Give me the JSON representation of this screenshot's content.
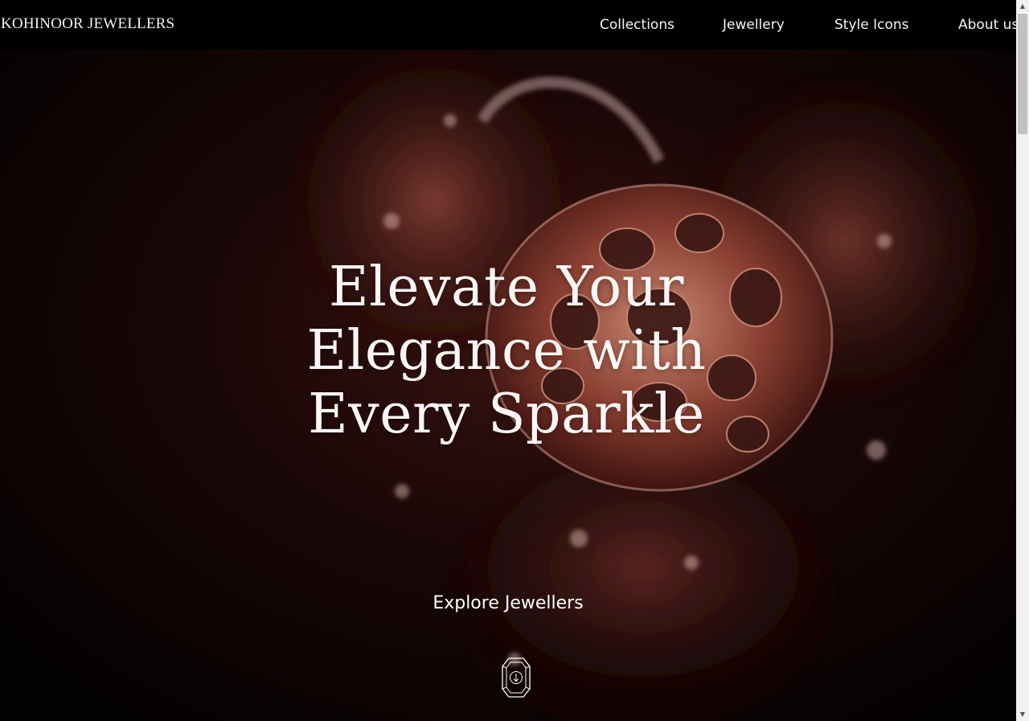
{
  "header": {
    "brand": "KOHINOOR JEWELLERS",
    "nav": [
      {
        "label": "Collections"
      },
      {
        "label": "Jewellery"
      },
      {
        "label": "Style Icons"
      },
      {
        "label": "About us"
      }
    ]
  },
  "hero": {
    "headline_lines": [
      "Elevate Your",
      "Elegance with",
      "Every Sparkle"
    ],
    "cta_label": "Explore Jewellers",
    "scroll_icon": "gem-down-arrow-icon"
  },
  "scrollbar": {
    "up_icon": "▲",
    "down_icon": "▼"
  },
  "colors": {
    "background": "#000000",
    "text": "#ffffff",
    "accent_rose_gold": "#b46a5a"
  }
}
